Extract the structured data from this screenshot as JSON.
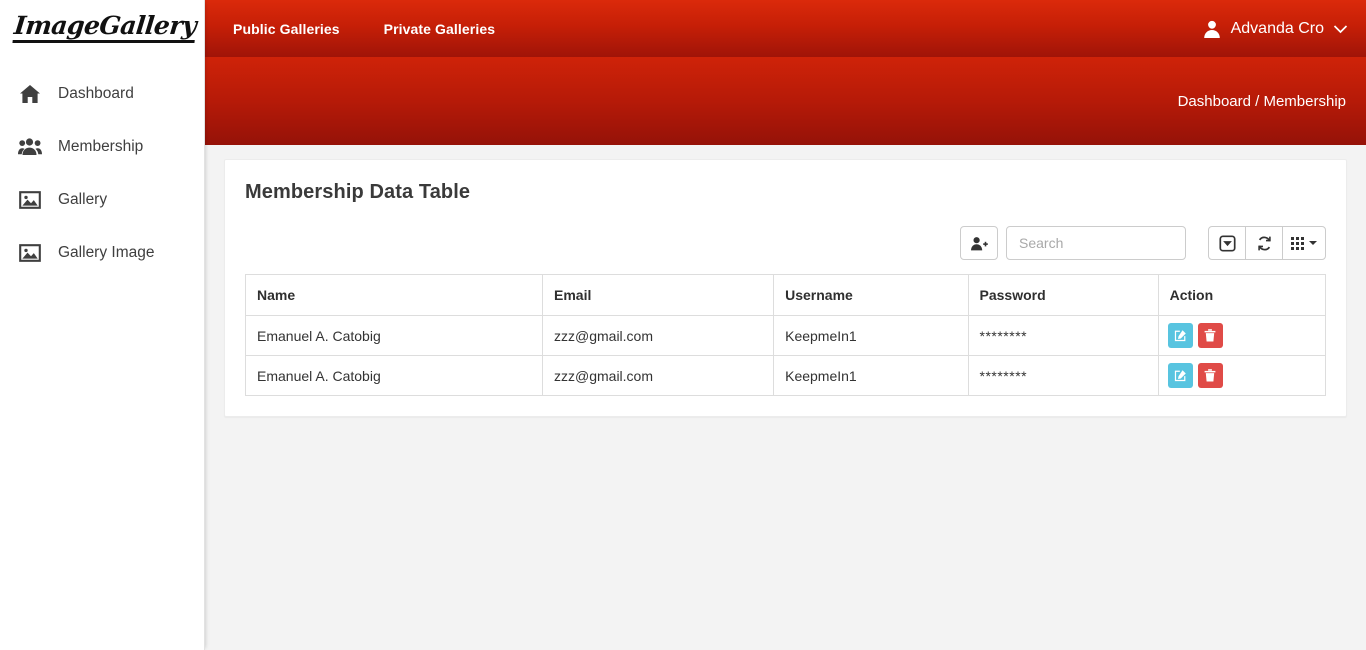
{
  "brand": {
    "logo_text": "ImageGallery"
  },
  "sidebar": {
    "items": [
      {
        "label": "Dashboard",
        "icon": "home-icon"
      },
      {
        "label": "Membership",
        "icon": "users-icon"
      },
      {
        "label": "Gallery",
        "icon": "image-icon"
      },
      {
        "label": "Gallery Image",
        "icon": "image-icon"
      }
    ]
  },
  "navbar": {
    "links": [
      {
        "label": "Public Galleries"
      },
      {
        "label": "Private Galleries"
      }
    ],
    "user": {
      "name": "Advanda Cro",
      "avatar_icon": "user-icon",
      "caret_icon": "chevron-down-icon"
    },
    "gradient_top": "#db2a0b",
    "gradient_bottom": "#a01408"
  },
  "breadcrumb": {
    "text": "Dashboard / Membership"
  },
  "card": {
    "title": "Membership Data Table"
  },
  "toolbar": {
    "add_user_icon": "add-user-icon",
    "search": {
      "placeholder": "Search",
      "value": ""
    },
    "buttons": [
      {
        "icon": "export-icon",
        "label": ""
      },
      {
        "icon": "refresh-icon",
        "label": ""
      },
      {
        "icon": "columns-grid-icon",
        "label": ""
      }
    ]
  },
  "table": {
    "columns": [
      "Name",
      "Email",
      "Username",
      "Password",
      "Action"
    ],
    "rows": [
      {
        "name": "Emanuel A. Catobig",
        "email": "zzz@gmail.com",
        "username": "KeepmeIn1",
        "password": "********",
        "actions": [
          {
            "icon": "edit-icon",
            "color": "#58c4e0"
          },
          {
            "icon": "delete-icon",
            "color": "#e04b47"
          }
        ]
      },
      {
        "name": "Emanuel A. Catobig",
        "email": "zzz@gmail.com",
        "username": "KeepmeIn1",
        "password": "********",
        "actions": [
          {
            "icon": "edit-icon",
            "color": "#58c4e0"
          },
          {
            "icon": "delete-icon",
            "color": "#e04b47"
          }
        ]
      }
    ]
  },
  "colors": {
    "brand_red": "#c61f07",
    "content_bg": "#f3f3f3",
    "edit_blue": "#58c4e0",
    "delete_red": "#e04b47"
  }
}
